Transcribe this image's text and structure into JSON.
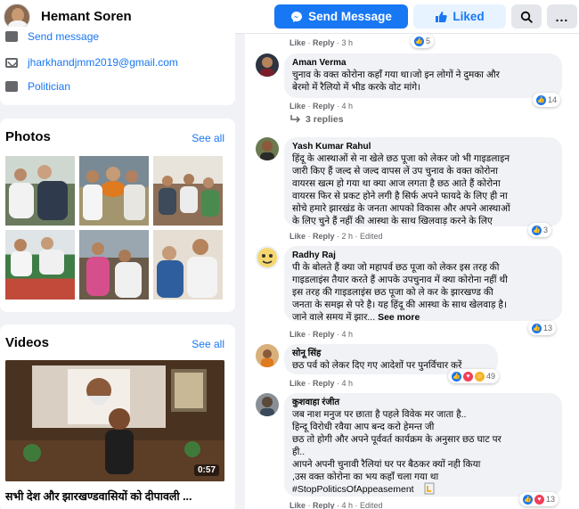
{
  "header": {
    "name": "Hemant Soren",
    "send_message": "Send Message",
    "liked": "Liked",
    "more": "..."
  },
  "intro": {
    "send_message_link": "Send message",
    "email": "jharkhandjmm2019@gmail.com",
    "category": "Politician"
  },
  "photos": {
    "title": "Photos",
    "see_all": "See all"
  },
  "videos": {
    "title": "Videos",
    "see_all": "See all",
    "duration": "0:57",
    "video_title": "सभी देश और झारखण्डवासियों को दीपावली ..."
  },
  "comments": [
    {
      "actions": {
        "like": "Like",
        "reply": "Reply",
        "time": "3 h"
      },
      "reactions": "5"
    },
    {
      "author": "Aman Verma",
      "text": "चुनाव के वक्त कोरोना कहाँ गया था।जो इन लोगों ने दुमका और\nबेरमो में रैलियो में भीड करके वोट मांगे।",
      "actions": {
        "like": "Like",
        "reply": "Reply",
        "time": "4 h"
      },
      "reactions": "14",
      "replies": "3 replies"
    },
    {
      "author": "Yash Kumar Rahul",
      "text": "हिंदू के आस्थाओं से ना खेले छठ पूजा को लेकर जो भी गाइडलाइन\nजारी किए हैं जल्द से जल्द वापस लें उप चुनाव के वक्त कोरोना\nवायरस खत्म हो गया था क्या आज लगता है छठ आते हैं कोरोना\nवायरस फिर से प्रकट होने लगी है सिर्फ अपने फायदे के लिए ही ना\nसोचे हमारे झारखंड के जनता आपको विकास और अपने आस्थाओं\nके लिए चुने हैं नहीं की आस्था के साथ खिलवाड़ करने के लिए",
      "actions": {
        "like": "Like",
        "reply": "Reply",
        "time": "2 h",
        "edited": "Edited"
      },
      "reactions": "3"
    },
    {
      "author": "Radhy Raj",
      "text": "पी के बोलते हैं क्या जो महापर्व छठ पूजा को लेकर इस तरह की\nगाइडलाइंस तैयार करते हैं आपके उपचुनाव में क्या कोरोना नहीं थी\nइस तरह की गाइडलाइंस छठ पूजा को ले कर के झारखण्ड की\nजनता के समझ से परे है। यह हिंदू की आस्था के साथ खेलवाड़ है।\nजाने वाले समय में झार...",
      "see_more": "See more",
      "actions": {
        "like": "Like",
        "reply": "Reply",
        "time": "4 h"
      },
      "reactions": "13"
    },
    {
      "author": "सोनू सिंह",
      "text": "छठ पर्व को लेकर दिए गए आदेशों पर पुनर्विचार करें",
      "actions": {
        "like": "Like",
        "reply": "Reply",
        "time": "4 h"
      },
      "reactions": "49"
    },
    {
      "author": "कुशवाहा रंजीत",
      "text": "जब नाश मनुज पर छाता है पहले विवेक मर जाता है..\nहिन्दू विरोधी रवैया आप बन्द करो हेमन्त जी\nछठ तो होगी और अपने पूर्ववर्त कार्यक्रम के अनुसार छठ घाट पर\nही..\nआपने अपनी चुनावी रैलियां घर पर बैठकर क्यों नही किया\n,उस वक्त कोरोना का भय कहाँ चला गया था\n#StopPoliticsOfAppeasement",
      "actions": {
        "like": "Like",
        "reply": "Reply",
        "time": "4 h",
        "edited": "Edited"
      },
      "reactions": "13"
    }
  ],
  "colors": {
    "brand": "#1877f2",
    "bubble": "#f0f2f5",
    "muted": "#65676b"
  }
}
